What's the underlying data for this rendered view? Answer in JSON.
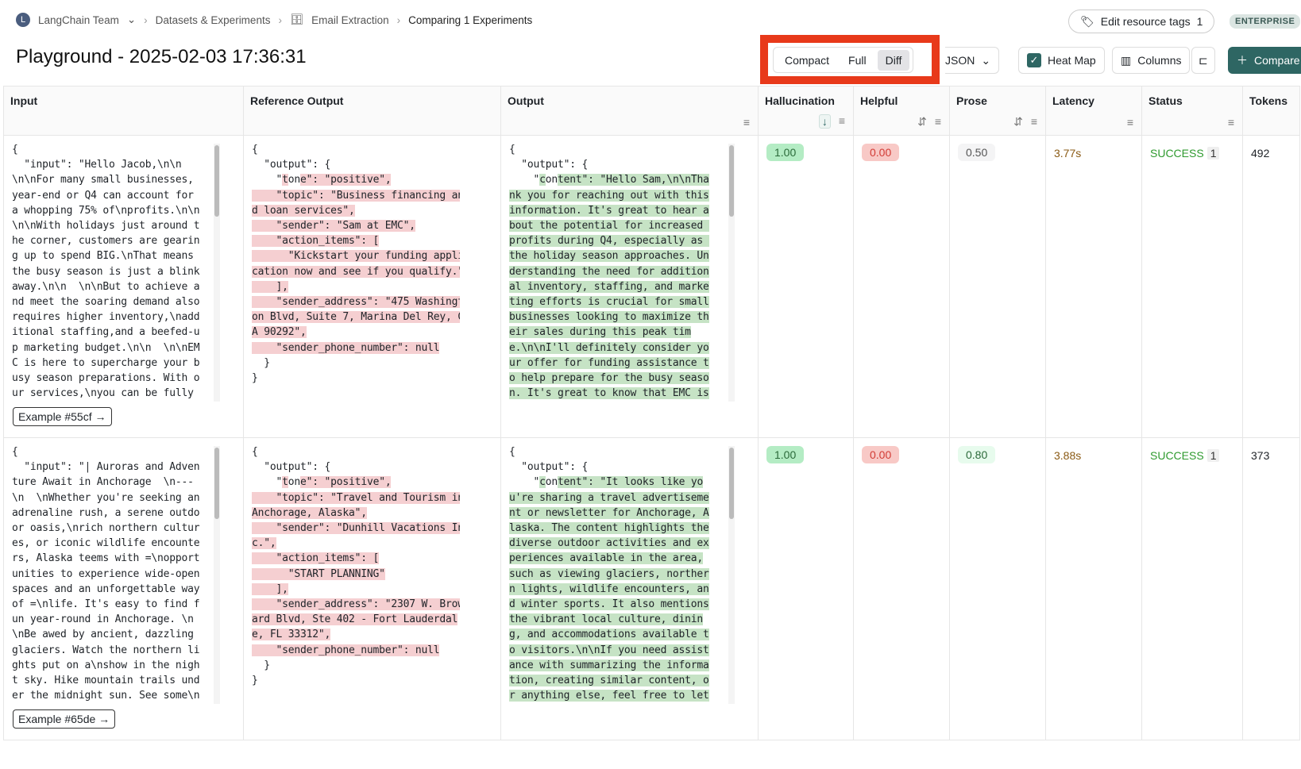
{
  "breadcrumb": {
    "avatar": "L",
    "team": "LangChain Team",
    "datasets": "Datasets & Experiments",
    "dataset": "Email Extraction",
    "current": "Comparing 1 Experiments"
  },
  "title": "Playground - 2025-02-03 17:36:31",
  "tags": {
    "label": "Edit resource tags",
    "count": "1"
  },
  "plan": "ENTERPRISE",
  "view_modes": {
    "options": [
      "Compact",
      "Full",
      "Diff"
    ],
    "selected": "Diff"
  },
  "toolbar": {
    "format": "JSON",
    "heatmap": "Heat Map",
    "heatmap_checked": true,
    "columns": "Columns",
    "compare": "Compare"
  },
  "colors": {
    "accent": "#2e6663",
    "highlight_box": "#e8391a",
    "diff_removed": "#f5cfd1",
    "diff_added": "#c6e3c5"
  },
  "columns": [
    "Input",
    "Reference Output",
    "Output",
    "Hallucination",
    "Helpful",
    "Prose",
    "Latency",
    "Status",
    "Tokens"
  ],
  "rows": [
    {
      "input": [
        "{",
        "  \"input\": \"Hello Jacob,\\n\\n",
        "\\n\\nFor many small businesses,",
        "year-end or Q4 can account for",
        "a whopping 75% of\\nprofits.\\n\\n",
        "\\n\\nWith holidays just around t",
        "he corner, customers are gearin",
        "g up to spend BIG.\\nThat means ",
        "the busy season is just a blink",
        "away.\\n\\n  \\n\\nBut to achieve a",
        "nd meet the soaring demand also",
        "requires higher inventory,\\nadd",
        "itional staffing,and a beefed-u",
        "p marketing budget.\\n\\n  \\n\\nEM",
        "C is here to supercharge your b",
        "usy season preparations. With o",
        "ur services,\\nyou can be fully "
      ],
      "reference": [
        [
          [
            "{",
            0
          ]
        ],
        [
          [
            "  \"output\": {",
            0
          ]
        ],
        [
          [
            "    \"",
            0
          ],
          [
            "t",
            1
          ],
          [
            "on",
            0
          ],
          [
            "e\": \"positive\",",
            1
          ]
        ],
        [
          [
            "    \"topic\": \"Business financing an",
            1
          ]
        ],
        [
          [
            "d loan services\",",
            1
          ]
        ],
        [
          [
            "    \"sender\": \"Sam at EMC\",",
            1
          ]
        ],
        [
          [
            "    \"action_items\": [",
            1
          ]
        ],
        [
          [
            "      \"Kickstart your funding appli",
            1
          ]
        ],
        [
          [
            "cation now and see if you qualify.\"",
            1
          ]
        ],
        [
          [
            "    ],",
            1
          ]
        ],
        [
          [
            "    \"sender_address\": \"475 Washingt",
            1
          ]
        ],
        [
          [
            "on Blvd, Suite 7, Marina Del Rey, C",
            1
          ]
        ],
        [
          [
            "A 90292\",",
            1
          ]
        ],
        [
          [
            "    \"sender_phone_number\": null",
            1
          ]
        ],
        [
          [
            "  }",
            0
          ]
        ],
        [
          [
            "}",
            0
          ]
        ]
      ],
      "output": [
        [
          [
            "{",
            0
          ]
        ],
        [
          [
            "  \"output\": {",
            0
          ]
        ],
        [
          [
            "    \"",
            0
          ],
          [
            "c",
            1
          ],
          [
            "on",
            0
          ],
          [
            "tent\": \"Hello Sam,\\n\\nTha",
            1
          ]
        ],
        [
          [
            "nk you for reaching out with this",
            1
          ]
        ],
        [
          [
            "information. It's great to hear a",
            1
          ]
        ],
        [
          [
            "bout the potential for increased ",
            1
          ]
        ],
        [
          [
            "profits during Q4, especially as ",
            1
          ]
        ],
        [
          [
            "the holiday season approaches. Un",
            1
          ]
        ],
        [
          [
            "derstanding the need for addition",
            1
          ]
        ],
        [
          [
            "al inventory, staffing, and marke",
            1
          ]
        ],
        [
          [
            "ting efforts is crucial for small",
            1
          ]
        ],
        [
          [
            "businesses looking to maximize th",
            1
          ]
        ],
        [
          [
            "eir sales during this peak tim",
            1
          ]
        ],
        [
          [
            "e.\\n\\nI'll definitely consider yo",
            1
          ]
        ],
        [
          [
            "ur offer for funding assistance t",
            1
          ]
        ],
        [
          [
            "o help prepare for the busy seaso",
            1
          ]
        ],
        [
          [
            "n. It's great to know that EMC is",
            1
          ]
        ]
      ],
      "example": "Example #55cf →",
      "hallucination": "1.00",
      "helpful": "0.00",
      "prose": "0.50",
      "prose_style": "n",
      "latency": "3.77s",
      "status": "SUCCESS",
      "status_count": "1",
      "tokens": "492"
    },
    {
      "input": [
        "{",
        "  \"input\": \"| Auroras and Adven",
        "ture Await in Anchorage  \\n---",
        "\\n  \\nWhether you're seeking an",
        "adrenaline rush, a serene outdo",
        "or oasis,\\nrich northern cultur",
        "es, or iconic wildlife encounte",
        "rs, Alaska teems with =\\nopport",
        "unities to experience wide-open",
        "spaces and an unforgettable way",
        "of =\\nlife. It's easy to find f",
        "un year-round in Anchorage. \\n",
        "\\nBe awed by ancient, dazzling",
        "glaciers. Watch the northern li",
        "ghts put on a\\nshow in the nigh",
        "t sky. Hike mountain trails und",
        "er the midnight sun. See some\\n"
      ],
      "reference": [
        [
          [
            "{",
            0
          ]
        ],
        [
          [
            "  \"output\": {",
            0
          ]
        ],
        [
          [
            "    \"",
            0
          ],
          [
            "t",
            1
          ],
          [
            "on",
            0
          ],
          [
            "e\": \"positive\",",
            1
          ]
        ],
        [
          [
            "    \"topic\": \"Travel and Tourism in",
            1
          ]
        ],
        [
          [
            "Anchorage, Alaska\",",
            1
          ]
        ],
        [
          [
            "    \"sender\": \"Dunhill Vacations In",
            1
          ]
        ],
        [
          [
            "c.\",",
            1
          ]
        ],
        [
          [
            "    \"action_items\": [",
            1
          ]
        ],
        [
          [
            "      \"START PLANNING\"",
            1
          ]
        ],
        [
          [
            "    ],",
            1
          ]
        ],
        [
          [
            "    \"sender_address\": \"2307 W. Brow",
            1
          ]
        ],
        [
          [
            "ard Blvd, Ste 402 - Fort Lauderdal",
            1
          ]
        ],
        [
          [
            "e, FL 33312\",",
            1
          ]
        ],
        [
          [
            "    \"sender_phone_number\": null",
            1
          ]
        ],
        [
          [
            "  }",
            0
          ]
        ],
        [
          [
            "}",
            0
          ]
        ]
      ],
      "output": [
        [
          [
            "{",
            0
          ]
        ],
        [
          [
            "  \"output\": {",
            0
          ]
        ],
        [
          [
            "    \"",
            0
          ],
          [
            "c",
            1
          ],
          [
            "on",
            0
          ],
          [
            "tent\": \"It looks like yo",
            1
          ]
        ],
        [
          [
            "u're sharing a travel advertiseme",
            1
          ]
        ],
        [
          [
            "nt or newsletter for Anchorage, A",
            1
          ]
        ],
        [
          [
            "laska. The content highlights the",
            1
          ]
        ],
        [
          [
            "diverse outdoor activities and ex",
            1
          ]
        ],
        [
          [
            "periences available in the area,",
            1
          ]
        ],
        [
          [
            "such as viewing glaciers, norther",
            1
          ]
        ],
        [
          [
            "n lights, wildlife encounters, an",
            1
          ]
        ],
        [
          [
            "d winter sports. It also mentions",
            1
          ]
        ],
        [
          [
            "the vibrant local culture, dinin",
            1
          ]
        ],
        [
          [
            "g, and accommodations available t",
            1
          ]
        ],
        [
          [
            "o visitors.\\n\\nIf you need assist",
            1
          ]
        ],
        [
          [
            "ance with summarizing the informa",
            1
          ]
        ],
        [
          [
            "tion, creating similar content, o",
            1
          ]
        ],
        [
          [
            "r anything else, feel free to let",
            1
          ]
        ]
      ],
      "example": "Example #65de →",
      "hallucination": "1.00",
      "helpful": "0.00",
      "prose": "0.80",
      "prose_style": "lg",
      "latency": "3.88s",
      "status": "SUCCESS",
      "status_count": "1",
      "tokens": "373"
    }
  ]
}
